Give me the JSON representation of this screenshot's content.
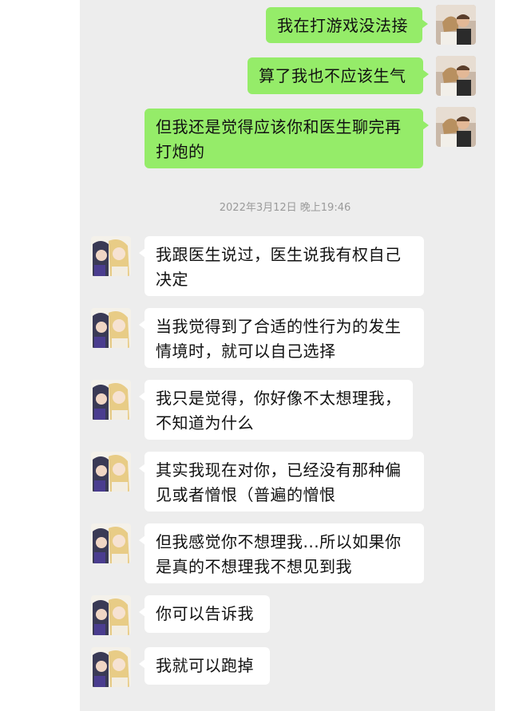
{
  "chat": {
    "outgoing": [
      "我在打游戏没法接",
      "算了我也不应该生气",
      "但我还是觉得应该你和医生聊完再\n打炮的"
    ],
    "timestamp": "2022年3月12日 晚上19:46",
    "incoming": [
      "我跟医生说过，医生说我有权自己\n决定",
      "当我觉得到了合适的性行为的发生\n情境时，就可以自己选择",
      "我只是觉得，你好像不太想理我，\n不知道为什么",
      "其实我现在对你，已经没有那种偏\n见或者憎恨（普遍的憎恨",
      "但我感觉你不想理我...所以如果你\n是真的不想理我不想见到我",
      "你可以告诉我",
      "我就可以跑掉"
    ]
  },
  "colors": {
    "outgoing_bubble": "#95ec69",
    "incoming_bubble": "#ffffff",
    "background": "#ededed"
  }
}
